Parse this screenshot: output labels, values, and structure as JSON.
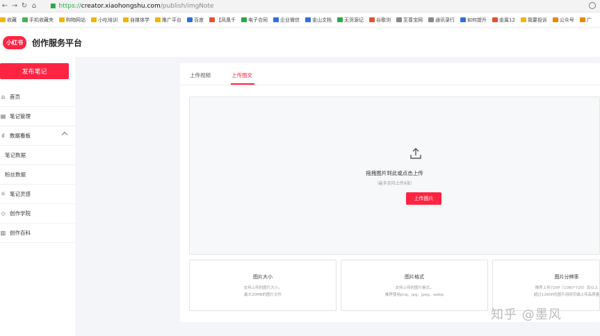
{
  "browser": {
    "url_scheme": "https://",
    "url_host": "creator.xiaohongshu.com",
    "url_path": "/publish/imgNote",
    "bookmarks": [
      {
        "label": "收藏",
        "color": "#f5b400"
      },
      {
        "label": "手机收藏夹",
        "color": "#4caf50"
      },
      {
        "label": "购物网站",
        "color": "#f5b400"
      },
      {
        "label": "小吃培训",
        "color": "#f5b400"
      },
      {
        "label": "自媒体学",
        "color": "#f5b400"
      },
      {
        "label": "推广平台",
        "color": "#f5b400"
      },
      {
        "label": "百度",
        "color": "#2f6fde"
      },
      {
        "label": "【凤凰千",
        "color": "#e5532d"
      },
      {
        "label": "电子合同",
        "color": "#2aa84a"
      },
      {
        "label": "企业微信",
        "color": "#2f6fde"
      },
      {
        "label": "金山文档",
        "color": "#2f6fde"
      },
      {
        "label": "无货源记",
        "color": "#2aa84a"
      },
      {
        "label": "谷歌浏",
        "color": "#e5532d"
      },
      {
        "label": "至尊宝网",
        "color": "#888888"
      },
      {
        "label": "通讯录行",
        "color": "#888888"
      },
      {
        "label": "如何提升",
        "color": "#2f6fde"
      },
      {
        "label": "金属12",
        "color": "#e5532d"
      },
      {
        "label": "我要投诉",
        "color": "#f5b400"
      },
      {
        "label": "公众号",
        "color": "#e58a00"
      },
      {
        "label": "广",
        "color": "#e58a00"
      }
    ]
  },
  "header": {
    "logo_text": "小红书",
    "platform_title": "创作服务平台"
  },
  "sidebar": {
    "publish_label": "发布笔记",
    "items": [
      {
        "label": "首页",
        "icon": "home-icon",
        "glyph": "⌂"
      },
      {
        "label": "笔记管理",
        "icon": "note-icon",
        "glyph": "▤"
      },
      {
        "label": "数据看板",
        "icon": "chart-icon",
        "glyph": "ıl"
      },
      {
        "label": "笔记数据",
        "sub": true
      },
      {
        "label": "粉丝数据",
        "sub": true
      },
      {
        "label": "笔记灵感",
        "icon": "bulb-icon",
        "glyph": "☼"
      },
      {
        "label": "创作学院",
        "icon": "academy-icon",
        "glyph": "◇"
      },
      {
        "label": "创作百科",
        "icon": "book-icon",
        "glyph": "▥"
      }
    ]
  },
  "main": {
    "tabs": [
      {
        "label": "上传视频",
        "active": false
      },
      {
        "label": "上传图文",
        "active": true
      }
    ],
    "dropzone": {
      "title": "拖拽图片到此或点击上传",
      "subtitle": "（最多支持上传9张）",
      "button_label": "上传图片"
    },
    "info_cards": [
      {
        "title": "图片大小",
        "lines": [
          "支持上传的图片大小，",
          "最大20MB的图片文件"
        ]
      },
      {
        "title": "图片格式",
        "lines": [
          "支持上传的图片格式，",
          "推荐使用png、jpg、jpeg、webp"
        ]
      },
      {
        "title": "图片分辨率",
        "lines": [
          "推荐上传720P（1080*720）及以上",
          "超过1280P的图片用网页端上传高质量"
        ]
      }
    ]
  },
  "watermark": "知乎 @墨风",
  "colors": {
    "accent": "#ff2442",
    "page_bg": "#f3f5f8"
  }
}
